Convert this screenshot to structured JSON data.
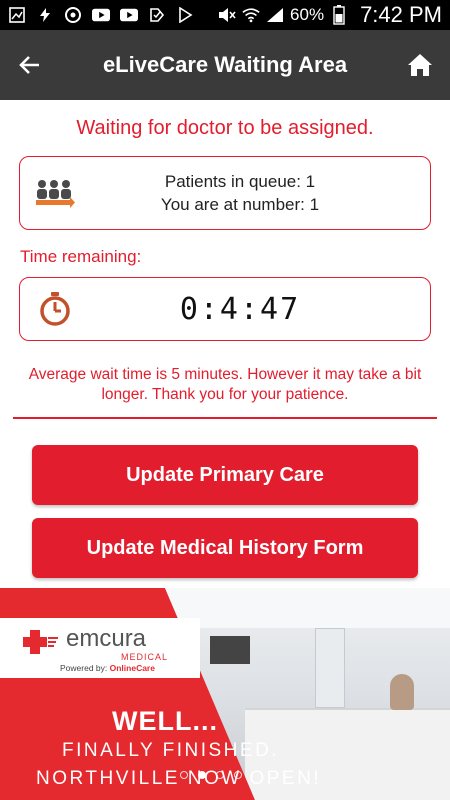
{
  "status_bar": {
    "battery": "60%",
    "time": "7:42 PM"
  },
  "app_bar": {
    "title": "eLiveCare Waiting Area"
  },
  "waiting": {
    "message": "Waiting for doctor to be assigned."
  },
  "queue": {
    "line1": "Patients in queue: 1",
    "line2": "You are at number: 1"
  },
  "timer": {
    "label": "Time remaining:",
    "value": "0:4:47"
  },
  "note": "Average wait time is 5 minutes. However it may take a bit longer. Thank you for your patience.",
  "buttons": {
    "primary_care": "Update Primary Care",
    "medical_history": "Update Medical History Form"
  },
  "banner": {
    "logo_name": "emcura",
    "logo_sub": "MEDICAL",
    "powered_by": "Powered by:",
    "powered_brand": "OnlineCare",
    "headline": "WELL...",
    "line1": "FINALLY FINISHED.",
    "line2": "NORTHVILLE NOW OPEN!",
    "carousel_dots": 4,
    "active_dot": 2
  },
  "colors": {
    "accent": "#e21d2d",
    "app_bar": "#3a3a3a",
    "status_bar": "#000000",
    "banner": "#e52a2f"
  }
}
